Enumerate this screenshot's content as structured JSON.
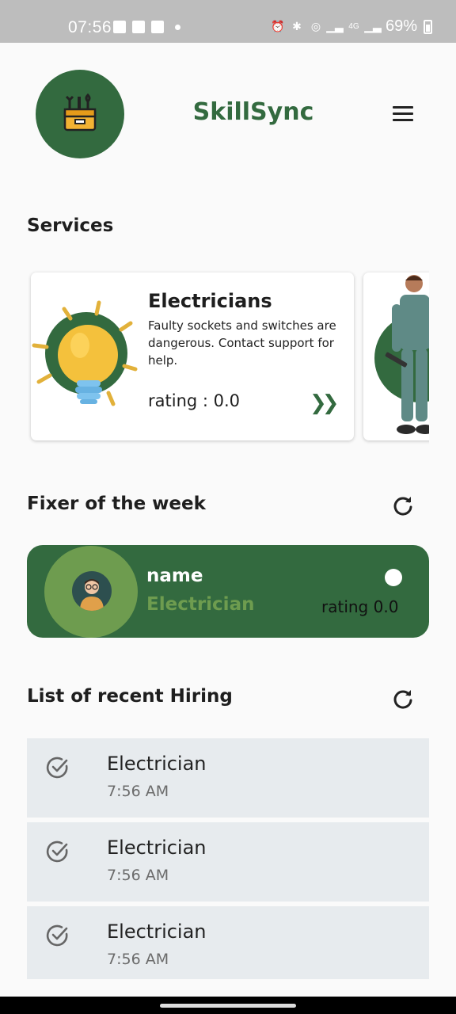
{
  "status_bar": {
    "time": "07:56",
    "battery": "69%"
  },
  "header": {
    "app_title": "SkillSync",
    "logo_icon": "toolbox-icon",
    "menu_icon": "hamburger-menu-icon",
    "brand_color": "#336a3f"
  },
  "services": {
    "title": "Services",
    "cards": [
      {
        "name": "Electricians",
        "description": "Faulty sockets and switches are dangerous. Contact support for help.",
        "rating_text": "rating : 0.0",
        "arrow_icon": "double-chevron-right-icon",
        "image_icon": "light-bulb-icon"
      },
      {
        "image_icon": "mechanic-person-icon"
      }
    ]
  },
  "fixer": {
    "title": "Fixer of the week",
    "refresh_icon": "refresh-icon",
    "name": "name",
    "role": "Electrician",
    "rating_text": "rating 0.0",
    "accent_color": "#6e9c4f"
  },
  "recent_hiring": {
    "title": "List of recent Hiring",
    "refresh_icon": "refresh-icon",
    "items": [
      {
        "title": "Electrician",
        "time": "7:56 AM",
        "icon": "check-circle-icon"
      },
      {
        "title": "Electrician",
        "time": "7:56 AM",
        "icon": "check-circle-icon"
      },
      {
        "title": "Electrician",
        "time": "7:56 AM",
        "icon": "check-circle-icon"
      }
    ]
  }
}
